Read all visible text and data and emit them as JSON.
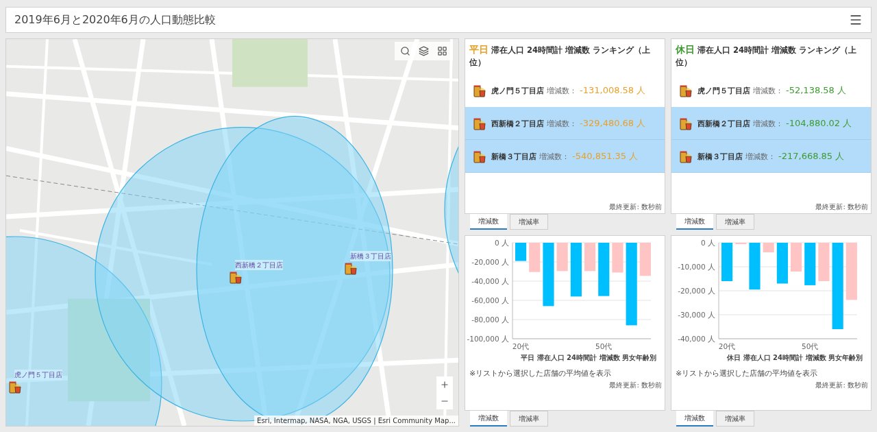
{
  "header": {
    "title": "2019年6月と2020年6月の人口動態比較"
  },
  "map": {
    "markers": [
      {
        "label": "西新橋２丁目店"
      },
      {
        "label": "新橋３丁目店"
      },
      {
        "label": "虎ノ門５丁目店"
      }
    ],
    "attribution": "Esri, Intermap, NASA, NGA, USGS | Esri Community Map..."
  },
  "ranking_panels": [
    {
      "day": "平日",
      "color": "#e8a02a",
      "title": "滞在人口 24時間計 増減数 ランキング（上位）",
      "updated": "最終更新: 数秒前",
      "rows": [
        {
          "store": "虎ノ門５丁目店",
          "label": "増減数：",
          "value": "-131,008.58 人",
          "selected": false
        },
        {
          "store": "西新橋２丁目店",
          "label": "増減数：",
          "value": "-329,480.68 人",
          "selected": true
        },
        {
          "store": "新橋３丁目店",
          "label": "増減数：",
          "value": "-540,851.35 人",
          "selected": true
        }
      ],
      "tabs": [
        {
          "label": "増減数",
          "selected": true
        },
        {
          "label": "増減率",
          "selected": false
        }
      ]
    },
    {
      "day": "休日",
      "color": "#3d9a2f",
      "title": "滞在人口 24時間計 増減数 ランキング（上位）",
      "updated": "最終更新: 数秒前",
      "rows": [
        {
          "store": "虎ノ門５丁目店",
          "label": "増減数：",
          "value": "-52,138.58 人",
          "selected": false
        },
        {
          "store": "西新橋２丁目店",
          "label": "増減数：",
          "value": "-104,880.02 人",
          "selected": true
        },
        {
          "store": "新橋３丁目店",
          "label": "増減数：",
          "value": "-217,668.85 人",
          "selected": true
        }
      ],
      "tabs": [
        {
          "label": "増減数",
          "selected": true
        },
        {
          "label": "増減率",
          "selected": false
        }
      ]
    }
  ],
  "chart_panels": [
    {
      "chart_data": {
        "type": "bar",
        "title": "平日 滞在人口 24時間計 増減数 男女年齢別",
        "stacked": false,
        "grid": true,
        "categories": [
          "20代",
          null,
          null,
          "50代",
          null
        ],
        "ylim": [
          -100000,
          0
        ],
        "yticks": [
          {
            "value": 0,
            "label": "0 人"
          },
          {
            "value": -20000,
            "label": "-20,000 人"
          },
          {
            "value": -40000,
            "label": "-40,000 人"
          },
          {
            "value": -60000,
            "label": "-60,000 人"
          },
          {
            "value": -80000,
            "label": "-80,000 人"
          },
          {
            "value": -100000,
            "label": "-100,000 人"
          }
        ],
        "series": [
          {
            "color": "#00bfff",
            "values": [
              -19000,
              -66000,
              -56000,
              -55500,
              -86000
            ]
          },
          {
            "color": "#ffc4c4",
            "values": [
              -30500,
              -29500,
              -29500,
              -31000,
              -34500
            ]
          }
        ]
      },
      "note": "※リストから選択した店舗の平均値を表示",
      "updated": "最終更新: 数秒前",
      "tabs": [
        {
          "label": "増減数",
          "selected": true
        },
        {
          "label": "増減率",
          "selected": false
        }
      ]
    },
    {
      "chart_data": {
        "type": "bar",
        "title": "休日 滞在人口 24時間計 増減数 男女年齢別",
        "stacked": false,
        "grid": true,
        "categories": [
          "20代",
          null,
          null,
          "50代",
          null
        ],
        "ylim": [
          -40000,
          0
        ],
        "yticks": [
          {
            "value": 0,
            "label": "0 人"
          },
          {
            "value": -10000,
            "label": "-10,000 人"
          },
          {
            "value": -20000,
            "label": "-20,000 人"
          },
          {
            "value": -30000,
            "label": "-30,000 人"
          },
          {
            "value": -40000,
            "label": "-40,000 人"
          }
        ],
        "series": [
          {
            "color": "#00bfff",
            "values": [
              -16000,
              -19500,
              -17000,
              -17700,
              -36000
            ]
          },
          {
            "color": "#ffc4c4",
            "values": [
              -600,
              -4000,
              -12000,
              -16000,
              -23800
            ]
          }
        ]
      },
      "note": "※リストから選択した店舗の平均値を表示",
      "updated": "最終更新: 数秒前",
      "tabs": [
        {
          "label": "増減数",
          "selected": true
        },
        {
          "label": "増減率",
          "selected": false
        }
      ]
    }
  ]
}
